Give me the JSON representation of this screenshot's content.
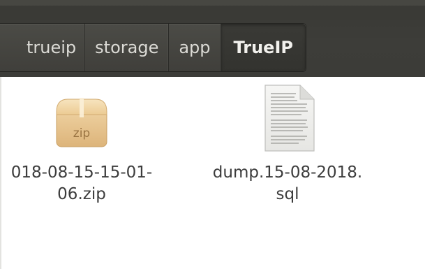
{
  "pathbar": {
    "crumbs": [
      "trueip",
      "storage",
      "app"
    ],
    "active": "TrueIP"
  },
  "files": [
    {
      "name_line1": "018-08-15-15-01-",
      "name_line2": "06.zip",
      "icon": "zip-archive-icon",
      "icon_label": "zip"
    },
    {
      "name_line1": "dump.15-08-2018.",
      "name_line2": "sql",
      "icon": "text-document-icon"
    }
  ],
  "colors": {
    "toolbar": "#3c3c38",
    "crumb_text": "#dcdbd6",
    "file_label": "#3c3c3c",
    "zip_box": "#e4c089"
  }
}
